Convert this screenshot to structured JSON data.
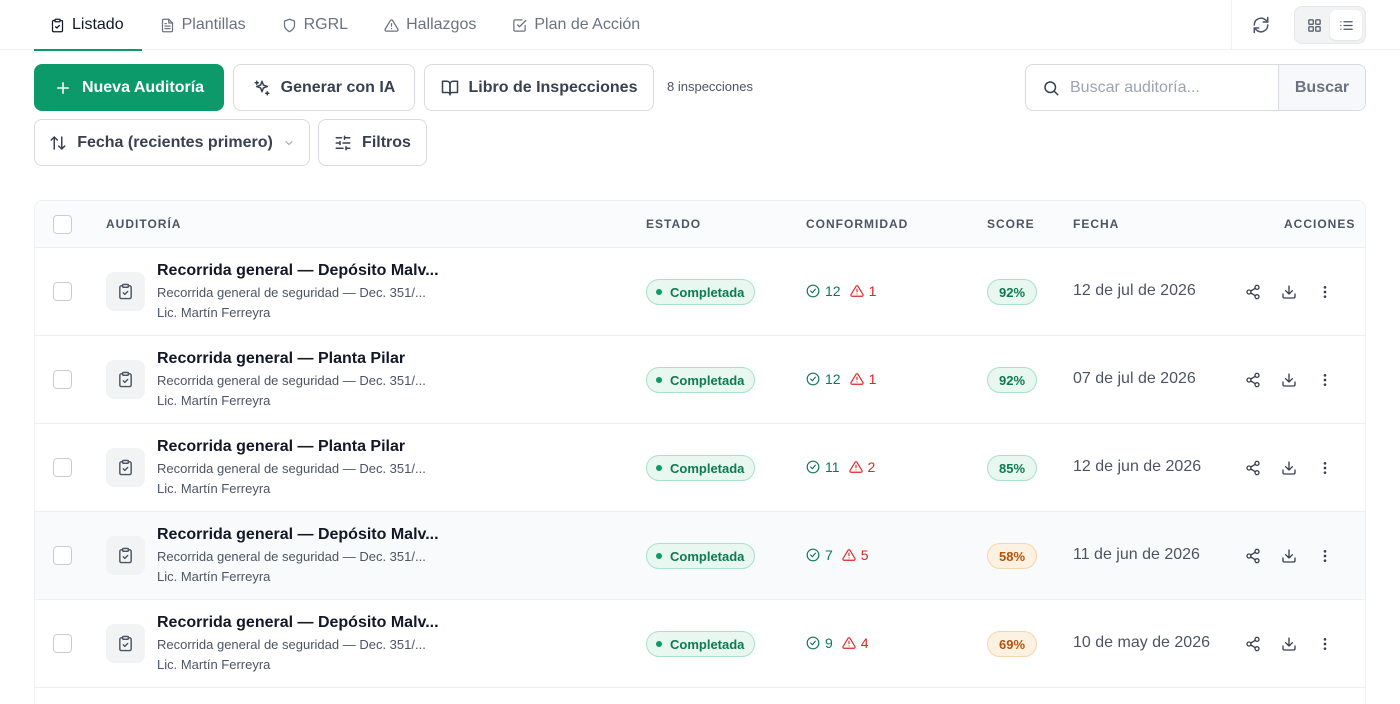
{
  "tabs": [
    {
      "label": "Listado",
      "icon": "clipboard-check-icon",
      "active": true
    },
    {
      "label": "Plantillas",
      "icon": "file-text-icon",
      "active": false
    },
    {
      "label": "RGRL",
      "icon": "shield-icon",
      "active": false
    },
    {
      "label": "Hallazgos",
      "icon": "alert-triangle-icon",
      "active": false
    },
    {
      "label": "Plan de Acción",
      "icon": "check-square-icon",
      "active": false
    }
  ],
  "toolbar": {
    "new_label": "Nueva Auditoría",
    "ai_label": "Generar con IA",
    "book_label": "Libro de Inspecciones",
    "count_text": "8 inspecciones",
    "sort_label": "Fecha (recientes primero)",
    "filters_label": "Filtros"
  },
  "search": {
    "placeholder": "Buscar auditoría...",
    "button_label": "Buscar"
  },
  "table": {
    "columns": {
      "auditoria": "AUDITORÍA",
      "estado": "ESTADO",
      "conformidad": "CONFORMIDAD",
      "score": "SCORE",
      "fecha": "FECHA",
      "acciones": "ACCIONES"
    },
    "rows": [
      {
        "title": "Recorrida general — Depósito Malv...",
        "subtitle": "Recorrida general de seguridad — Dec. 351/...",
        "author": "Lic. Martín Ferreyra",
        "status": "Completada",
        "ok": "12",
        "bad": "1",
        "score": "92%",
        "score_level": "good",
        "date": "12 de jul de 2026"
      },
      {
        "title": "Recorrida general — Planta Pilar",
        "subtitle": "Recorrida general de seguridad — Dec. 351/...",
        "author": "Lic. Martín Ferreyra",
        "status": "Completada",
        "ok": "12",
        "bad": "1",
        "score": "92%",
        "score_level": "good",
        "date": "07 de jul de 2026"
      },
      {
        "title": "Recorrida general — Planta Pilar",
        "subtitle": "Recorrida general de seguridad — Dec. 351/...",
        "author": "Lic. Martín Ferreyra",
        "status": "Completada",
        "ok": "11",
        "bad": "2",
        "score": "85%",
        "score_level": "good",
        "date": "12 de jun de 2026"
      },
      {
        "title": "Recorrida general — Depósito Malv...",
        "subtitle": "Recorrida general de seguridad — Dec. 351/...",
        "author": "Lic. Martín Ferreyra",
        "status": "Completada",
        "ok": "7",
        "bad": "5",
        "score": "58%",
        "score_level": "warn",
        "date": "11 de jun de 2026"
      },
      {
        "title": "Recorrida general — Depósito Malv...",
        "subtitle": "Recorrida general de seguridad — Dec. 351/...",
        "author": "Lic. Martín Ferreyra",
        "status": "Completada",
        "ok": "9",
        "bad": "4",
        "score": "69%",
        "score_level": "warn",
        "date": "10 de may de 2026"
      }
    ]
  },
  "colors": {
    "accent": "#0c9a6b",
    "score_good": "#0b7a55",
    "score_warn": "#b45309",
    "nonconformity": "#dc2626"
  }
}
